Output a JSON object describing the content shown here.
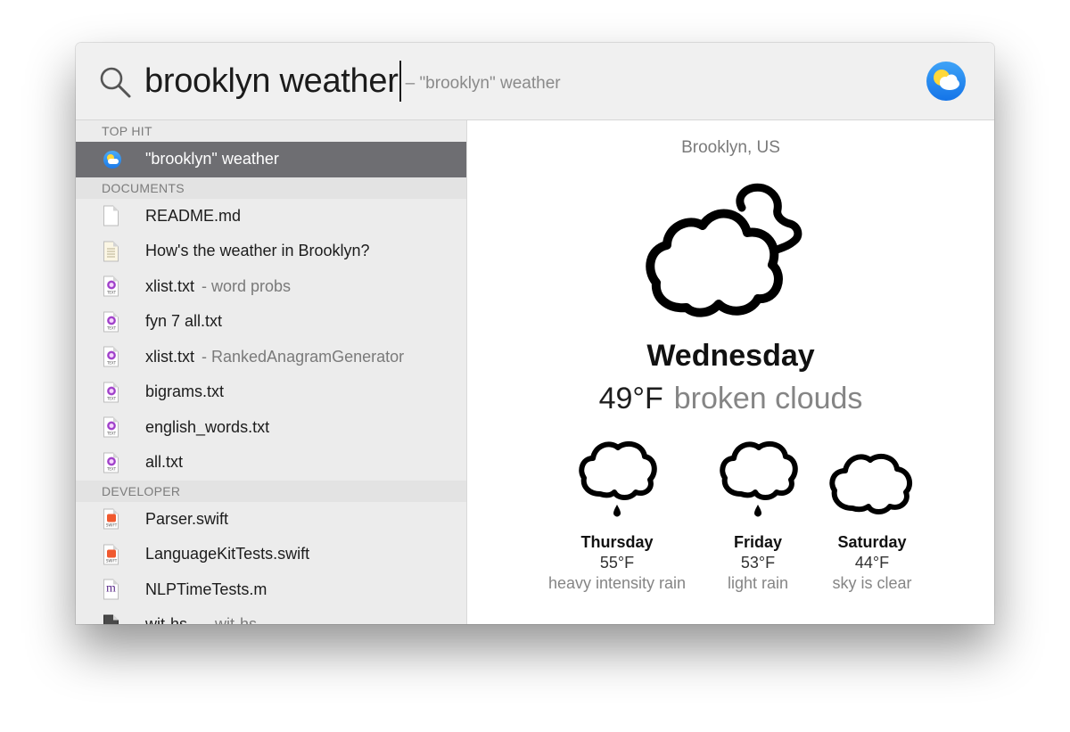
{
  "search": {
    "query": "brooklyn weather",
    "completion_hint": "– \"brooklyn\" weather"
  },
  "sections": [
    {
      "title": "TOP HIT",
      "items": [
        {
          "label": "\"brooklyn\" weather",
          "sub": "",
          "icon": "weather-app-icon",
          "selected": true
        }
      ]
    },
    {
      "title": "DOCUMENTS",
      "items": [
        {
          "label": "README.md",
          "sub": "",
          "icon": "blank-document-icon"
        },
        {
          "label": "How's the weather in Brooklyn?",
          "sub": "",
          "icon": "note-document-icon"
        },
        {
          "label": "xlist.txt",
          "sub": "- word probs",
          "icon": "text-file-icon"
        },
        {
          "label": "fyn 7 all.txt",
          "sub": "",
          "icon": "text-file-icon"
        },
        {
          "label": "xlist.txt",
          "sub": "- RankedAnagramGenerator",
          "icon": "text-file-icon"
        },
        {
          "label": "bigrams.txt",
          "sub": "",
          "icon": "text-file-icon"
        },
        {
          "label": "english_words.txt",
          "sub": "",
          "icon": "text-file-icon"
        },
        {
          "label": "all.txt",
          "sub": "",
          "icon": "text-file-icon"
        }
      ]
    },
    {
      "title": "DEVELOPER",
      "items": [
        {
          "label": "Parser.swift",
          "sub": "",
          "icon": "swift-file-icon"
        },
        {
          "label": "LanguageKitTests.swift",
          "sub": "",
          "icon": "swift-file-icon"
        },
        {
          "label": "NLPTimeTests.m",
          "sub": "",
          "icon": "objc-file-icon"
        },
        {
          "label": "wit-hs",
          "sub": "— wit-hs",
          "icon": "executable-file-icon"
        }
      ]
    }
  ],
  "weather": {
    "location": "Brooklyn, US",
    "day": "Wednesday",
    "temperature": "49°F",
    "condition": "broken clouds",
    "icon": "cloud-moon-icon",
    "forecast": [
      {
        "day": "Thursday",
        "temp": "55°F",
        "condition": "heavy intensity rain",
        "icon": "cloud-rain-icon"
      },
      {
        "day": "Friday",
        "temp": "53°F",
        "condition": "light rain",
        "icon": "cloud-rain-icon"
      },
      {
        "day": "Saturday",
        "temp": "44°F",
        "condition": "sky is clear",
        "icon": "cloud-icon"
      }
    ]
  },
  "colors": {
    "selection": "#6e6e72",
    "sidebar_bg": "#ececec",
    "section_bg": "#e3e3e3",
    "search_bg": "#f0f0f0",
    "weather_icon_blue": "#1c7ae9"
  }
}
